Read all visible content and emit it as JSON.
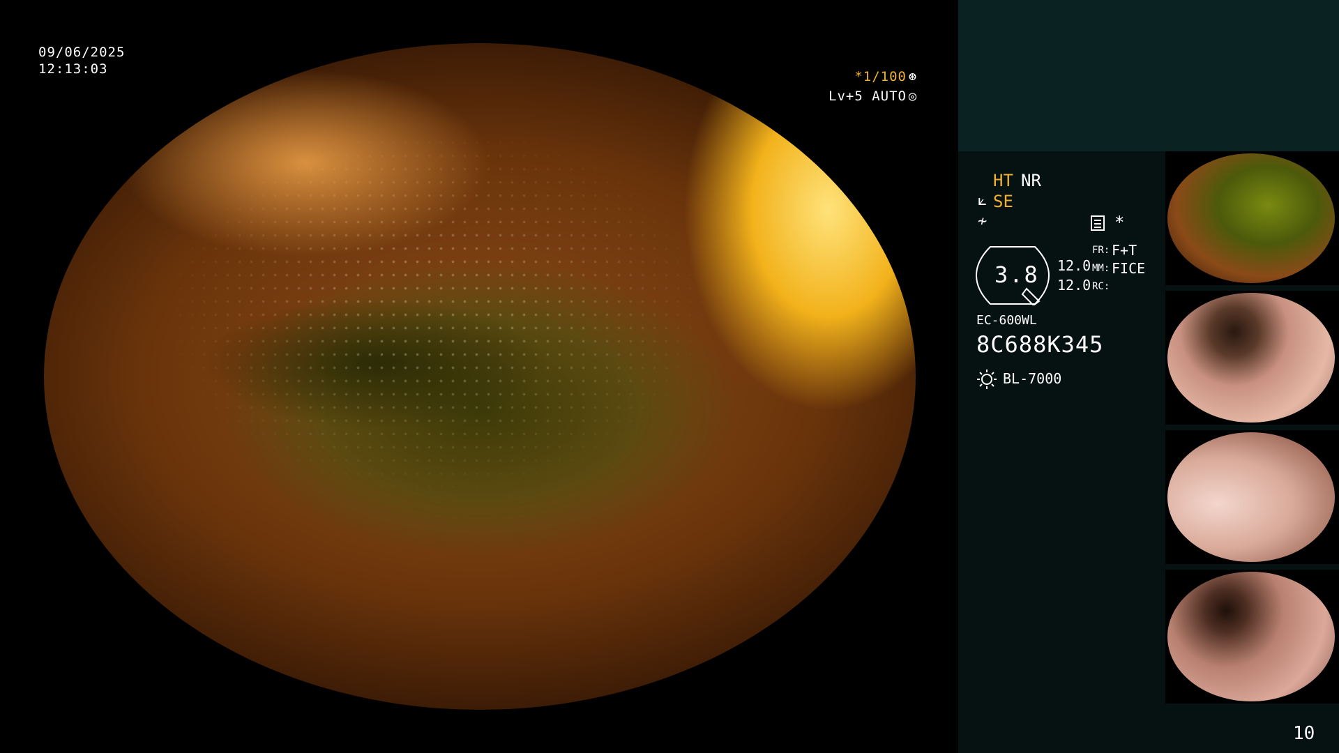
{
  "overlay": {
    "date": "09/06/2025",
    "time": "12:13:03",
    "shutter": "*1/100",
    "shutter_icon": "aperture-icon",
    "level": "Lv+5 AUTO",
    "level_icon": "iris-icon"
  },
  "sidebar": {
    "ht": "HT",
    "nr": "NR",
    "se": "SE",
    "se_icon": "enhance-icon",
    "slash_icon": "slash-icon",
    "doc_icon": "menu-icon",
    "asterisk": "*",
    "zoom_value": "3.8",
    "val_a": "12.0",
    "val_b": "12.0",
    "fr_label": "FR:",
    "fr_value": "F+T",
    "mm_label": "MM:",
    "mm_value": "FICE",
    "rc_label": "RC:",
    "scope_model": "EC-600WL",
    "serial": "8C688K345",
    "light_source": "BL-7000",
    "page_number": "10"
  },
  "colors": {
    "accent_orange": "#f0b030",
    "sidebar_bg": "#061212",
    "sidebar_top_bg": "#0a2222"
  },
  "thumbnails": [
    {
      "name": "thumbnail-1"
    },
    {
      "name": "thumbnail-2"
    },
    {
      "name": "thumbnail-3"
    },
    {
      "name": "thumbnail-4"
    }
  ]
}
